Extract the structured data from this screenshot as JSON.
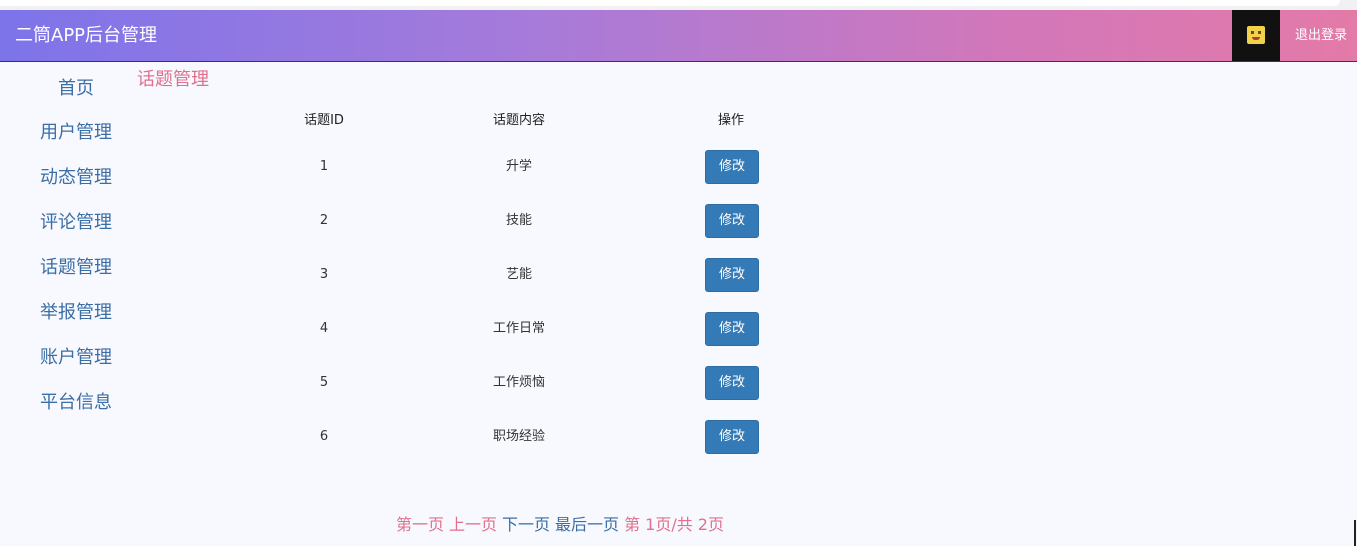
{
  "header": {
    "title": "二筒APP后台管理",
    "logout_label": "退出登录",
    "gradient_start": "#7d74ea",
    "gradient_end": "#e37aa8"
  },
  "sidebar": {
    "items": [
      {
        "label": "首页"
      },
      {
        "label": "用户管理"
      },
      {
        "label": "动态管理"
      },
      {
        "label": "评论管理"
      },
      {
        "label": "话题管理"
      },
      {
        "label": "举报管理"
      },
      {
        "label": "账户管理"
      },
      {
        "label": "平台信息"
      }
    ]
  },
  "main": {
    "section_title": "话题管理",
    "table": {
      "headers": [
        "话题ID",
        "话题内容",
        "操作"
      ],
      "rows": [
        {
          "id": "1",
          "content": "升学",
          "action": "修改"
        },
        {
          "id": "2",
          "content": "技能",
          "action": "修改"
        },
        {
          "id": "3",
          "content": "艺能",
          "action": "修改"
        },
        {
          "id": "4",
          "content": "工作日常",
          "action": "修改"
        },
        {
          "id": "5",
          "content": "工作烦恼",
          "action": "修改"
        },
        {
          "id": "6",
          "content": "职场经验",
          "action": "修改"
        }
      ]
    },
    "pagination": {
      "first": "第一页",
      "prev": "上一页",
      "next": "下一页",
      "last": "最后一页",
      "info": "第 1页/共 2页"
    }
  },
  "colors": {
    "accent_pink": "#e0708b",
    "link_blue": "#3a6ea5",
    "button_blue": "#337ab7"
  }
}
